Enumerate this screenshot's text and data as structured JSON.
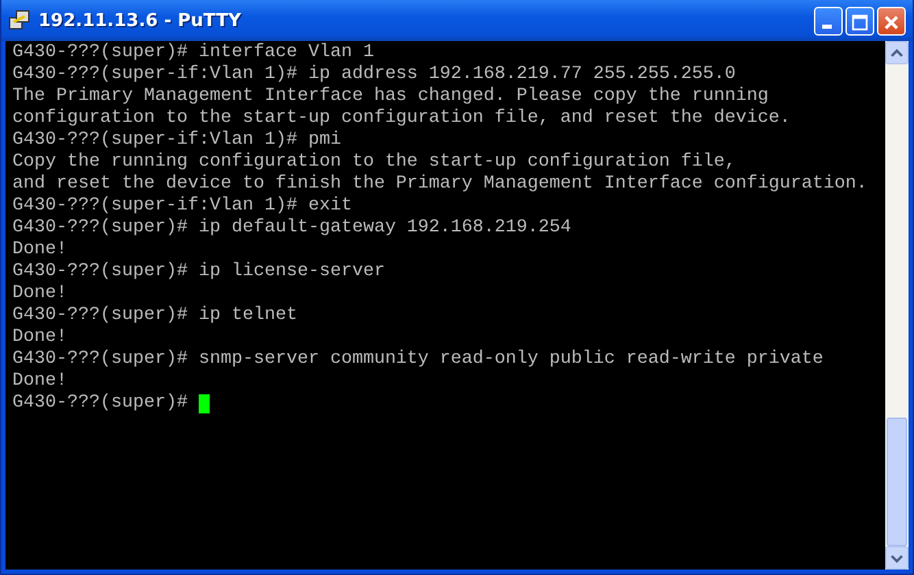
{
  "window": {
    "title": "192.11.13.6 - PuTTY"
  },
  "terminal": {
    "lines": [
      "G430-???(super)# interface Vlan 1",
      "G430-???(super-if:Vlan 1)# ip address 192.168.219.77 255.255.255.0",
      "The Primary Management Interface has changed. Please copy the running",
      "configuration to the start-up configuration file, and reset the device.",
      "G430-???(super-if:Vlan 1)# pmi",
      "Copy the running configuration to the start-up configuration file,",
      "and reset the device to finish the Primary Management Interface configuration.",
      "G430-???(super-if:Vlan 1)# exit",
      "G430-???(super)# ip default-gateway 192.168.219.254",
      "Done!",
      "G430-???(super)# ip license-server",
      "Done!",
      "G430-???(super)# ip telnet",
      "Done!",
      "G430-???(super)# snmp-server community read-only public read-write private",
      "Done!"
    ],
    "prompt": "G430-???(super)#"
  }
}
